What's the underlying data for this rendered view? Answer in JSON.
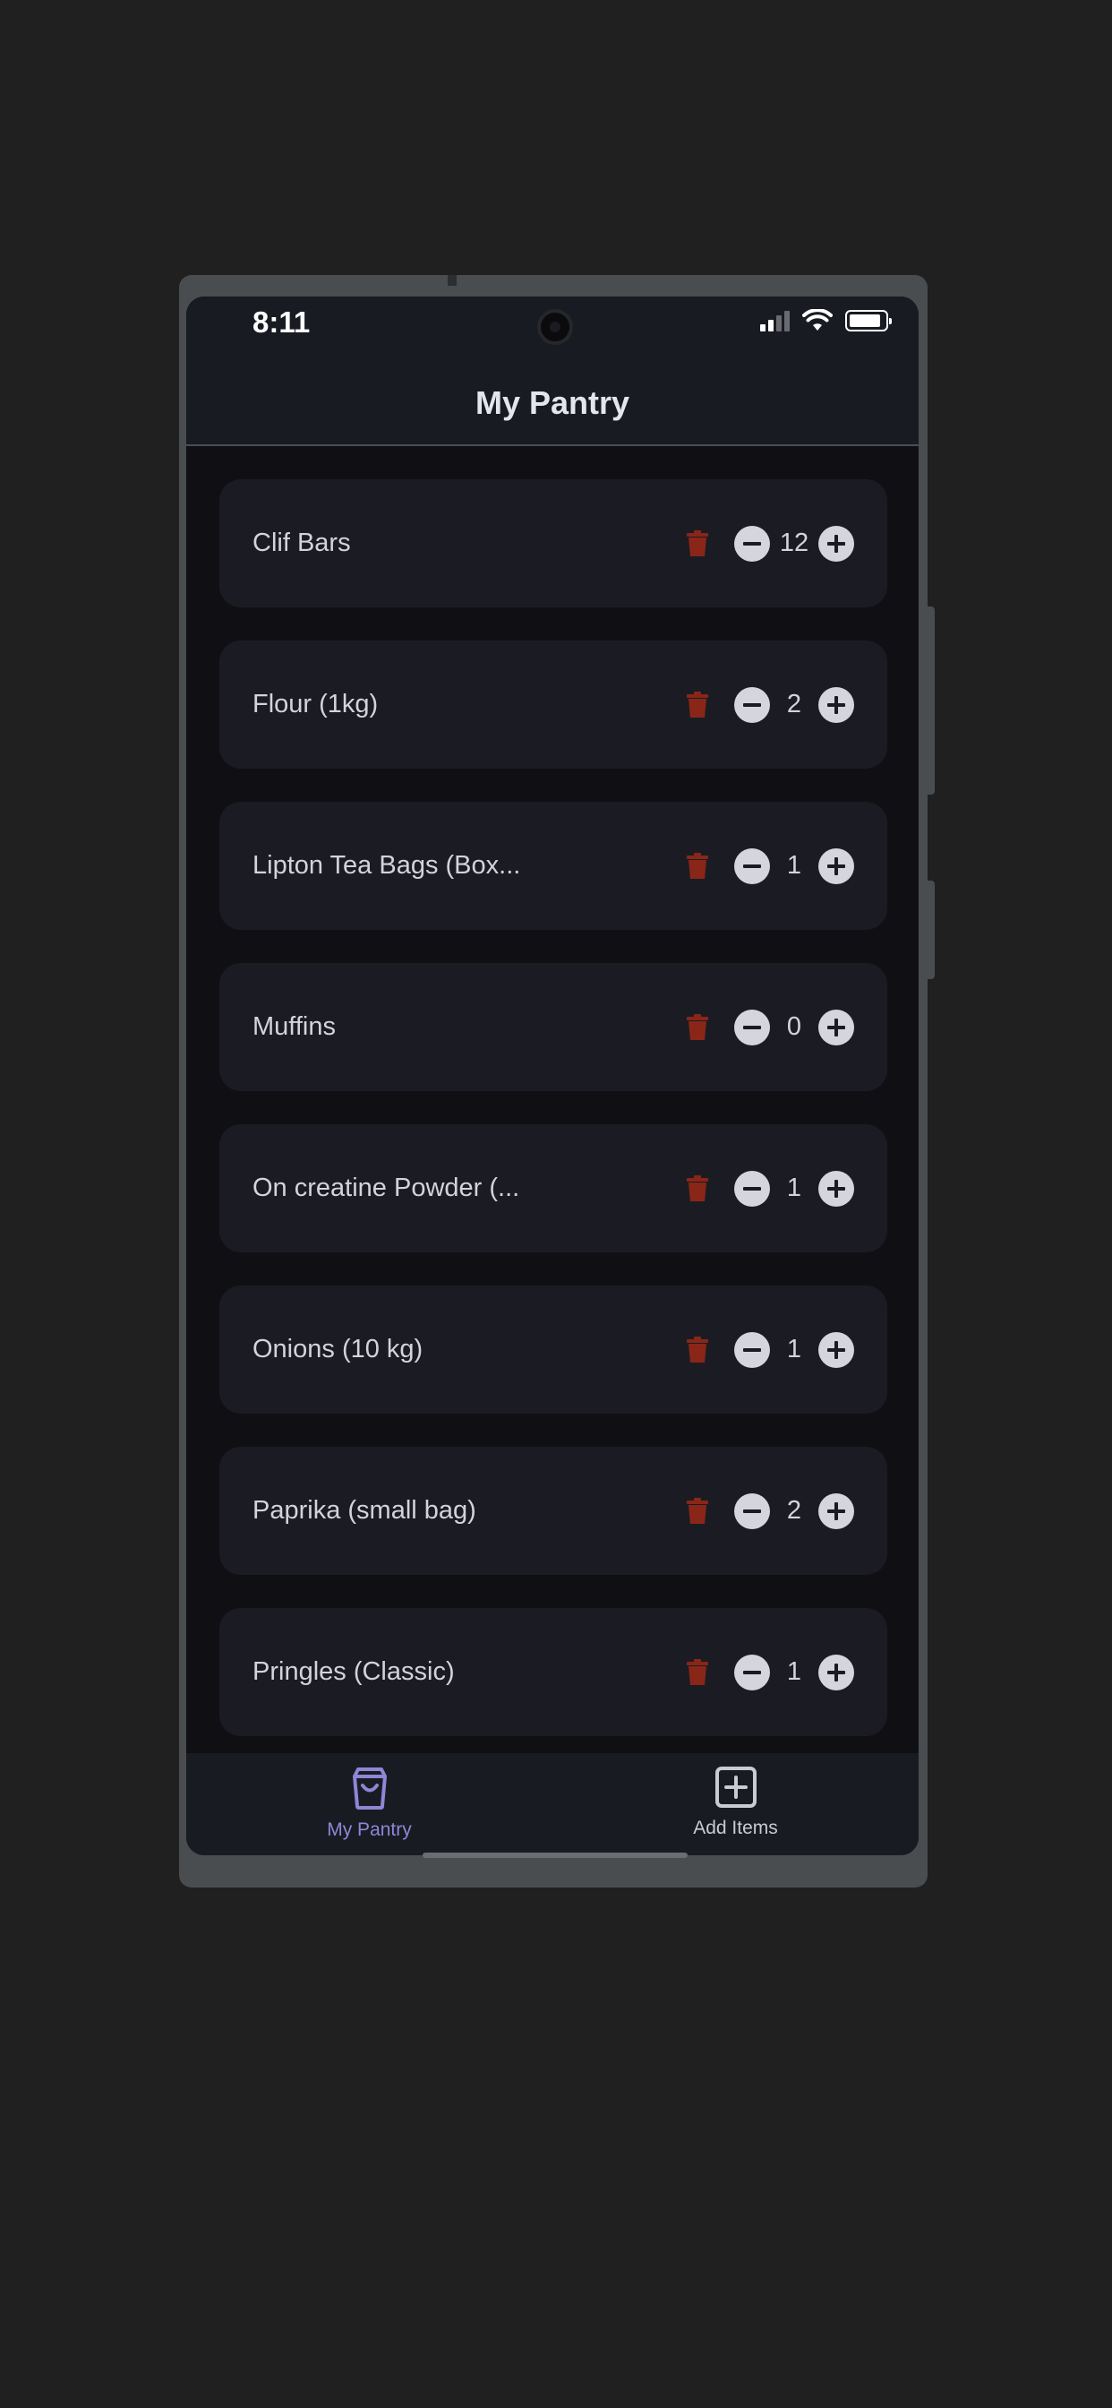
{
  "status_bar": {
    "time": "8:11"
  },
  "header": {
    "title": "My Pantry"
  },
  "items": [
    {
      "name": "Clif Bars",
      "quantity": "12"
    },
    {
      "name": "Flour (1kg)",
      "quantity": "2"
    },
    {
      "name": "Lipton Tea Bags (Box...",
      "quantity": "1"
    },
    {
      "name": "Muffins",
      "quantity": "0"
    },
    {
      "name": "On creatine Powder (...",
      "quantity": "1"
    },
    {
      "name": "Onions (10 kg)",
      "quantity": "1"
    },
    {
      "name": "Paprika (small bag)",
      "quantity": "2"
    },
    {
      "name": "Pringles (Classic)",
      "quantity": "1"
    }
  ],
  "tabs": [
    {
      "label": "My Pantry",
      "icon": "shopping-bag-icon",
      "active": true
    },
    {
      "label": "Add Items",
      "icon": "plus-square-icon",
      "active": false
    }
  ],
  "colors": {
    "accent": "#8f86d6",
    "delete": "#8a2618",
    "control": "#d5d6dc",
    "background": "#101014",
    "card": "#1b1c23"
  }
}
